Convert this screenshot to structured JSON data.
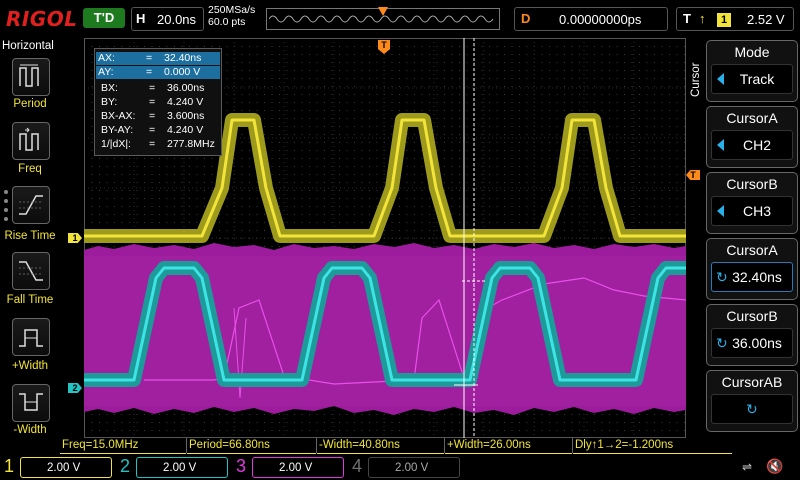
{
  "topbar": {
    "logo": "RIGOL",
    "trigger_status": "T'D",
    "timebase_label": "H",
    "timebase_value": "20.0ns",
    "sample_rate": "250MSa/s",
    "memory_depth": "60.0 pts",
    "memory_marker": "T",
    "delay_label": "D",
    "delay_value": "0.00000000ps",
    "trigger_label": "T",
    "trigger_edge_icon": "rising-edge-icon",
    "trigger_source": "1",
    "trigger_level": "2.52 V"
  },
  "left_panel": {
    "title": "Horizontal",
    "items": [
      {
        "label": "Period",
        "icon": "period-icon"
      },
      {
        "label": "Freq",
        "icon": "freq-icon"
      },
      {
        "label": "Rise Time",
        "icon": "rise-time-icon"
      },
      {
        "label": "Fall Time",
        "icon": "fall-time-icon"
      },
      {
        "label": "+Width",
        "icon": "pos-width-icon"
      },
      {
        "label": "-Width",
        "icon": "neg-width-icon"
      }
    ]
  },
  "cursor_readout": {
    "rows": [
      {
        "key": "AX:",
        "eq": "=",
        "value": "32.40ns"
      },
      {
        "key": "AY:",
        "eq": "=",
        "value": "0.000 V"
      },
      {
        "key": "BX:",
        "eq": "=",
        "value": "36.00ns"
      },
      {
        "key": "BY:",
        "eq": "=",
        "value": "4.240 V"
      },
      {
        "key": "BX-AX:",
        "eq": "=",
        "value": "3.600ns"
      },
      {
        "key": "BY-AY:",
        "eq": "=",
        "value": "4.240 V"
      },
      {
        "key": "1/|dX|:",
        "eq": "=",
        "value": "277.8MHz"
      }
    ]
  },
  "markers": {
    "ch1": "1",
    "ch2": "2",
    "trigger_level": "T",
    "trigger_position": "T"
  },
  "right_menu": {
    "title": "Cursor",
    "buttons": [
      {
        "title": "Mode",
        "value": "Track",
        "icon": "left-arrow-icon"
      },
      {
        "title": "CursorA",
        "value": "CH2",
        "icon": "left-arrow-icon"
      },
      {
        "title": "CursorB",
        "value": "CH3",
        "icon": "left-arrow-icon"
      },
      {
        "title": "CursorA",
        "value": "32.40ns",
        "icon": "knob-icon"
      },
      {
        "title": "CursorB",
        "value": "36.00ns",
        "icon": "knob-icon"
      },
      {
        "title": "CursorAB",
        "value": "",
        "icon": "knob-icon"
      }
    ]
  },
  "measurements": [
    "Freq=15.0MHz",
    "Period=66.80ns",
    "-Width=40.80ns",
    "+Width=26.00ns",
    "Dly↑1→2=-1.200ns"
  ],
  "channels": [
    {
      "num": "1",
      "scale": "2.00 V",
      "color": "#f2e43a"
    },
    {
      "num": "2",
      "scale": "2.00 V",
      "color": "#22c3c3"
    },
    {
      "num": "3",
      "scale": "2.00 V",
      "color": "#e038e0"
    },
    {
      "num": "4",
      "scale": "2.00 V",
      "color": "#3a5fe0"
    }
  ],
  "status_icons": {
    "usb": "usb-icon",
    "speaker": "speaker-muted-icon"
  },
  "colors": {
    "ch1": "#f2e43a",
    "ch2": "#22c3c3",
    "ch3": "#c830c8",
    "trigger": "#ff8a1c",
    "accent": "#2ab0e8"
  }
}
